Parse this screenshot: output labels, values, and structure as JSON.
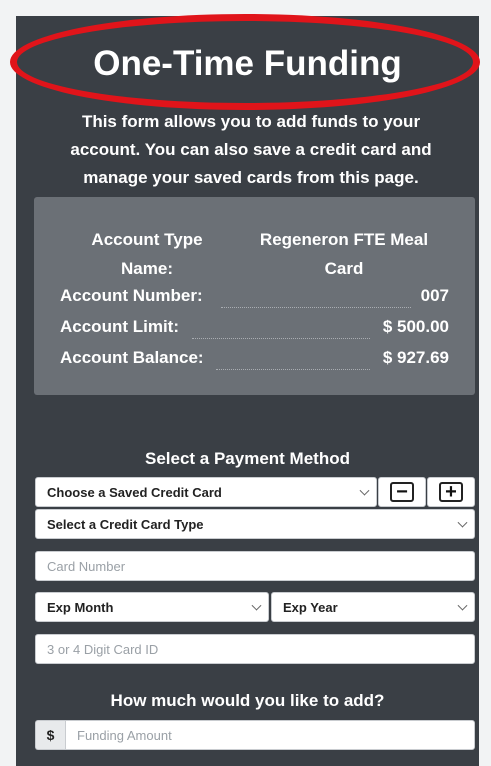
{
  "header": {
    "title": "One-Time Funding",
    "intro_lines": [
      "This form allows you to add funds to your",
      "account. You can also save a credit card and",
      "manage your saved cards from this page."
    ]
  },
  "account": {
    "type_label_line1": "Account Type",
    "type_label_line2": "Name:",
    "type_value_line1": "Regeneron FTE Meal",
    "type_value_line2": "Card",
    "number_label": "Account Number:",
    "number_value": "007",
    "limit_label": "Account Limit:",
    "limit_value": "$ 500.00",
    "balance_label": "Account Balance:",
    "balance_value": "$ 927.69"
  },
  "payment": {
    "title": "Select a Payment Method",
    "saved_card_select": "Choose a Saved Credit Card",
    "remove_button": "−",
    "add_button": "+",
    "card_type_select": "Select a Credit Card Type",
    "card_number_placeholder": "Card Number",
    "exp_month_select": "Exp Month",
    "exp_year_select": "Exp Year",
    "card_id_placeholder": "3 or 4 Digit Card ID"
  },
  "funding": {
    "title": "How much would you like to add?",
    "currency_symbol": "$",
    "amount_placeholder": "Funding Amount"
  },
  "colors": {
    "panel": "#3a3f45",
    "account_box": "#6b7076",
    "highlight_ring": "#e0141a"
  }
}
